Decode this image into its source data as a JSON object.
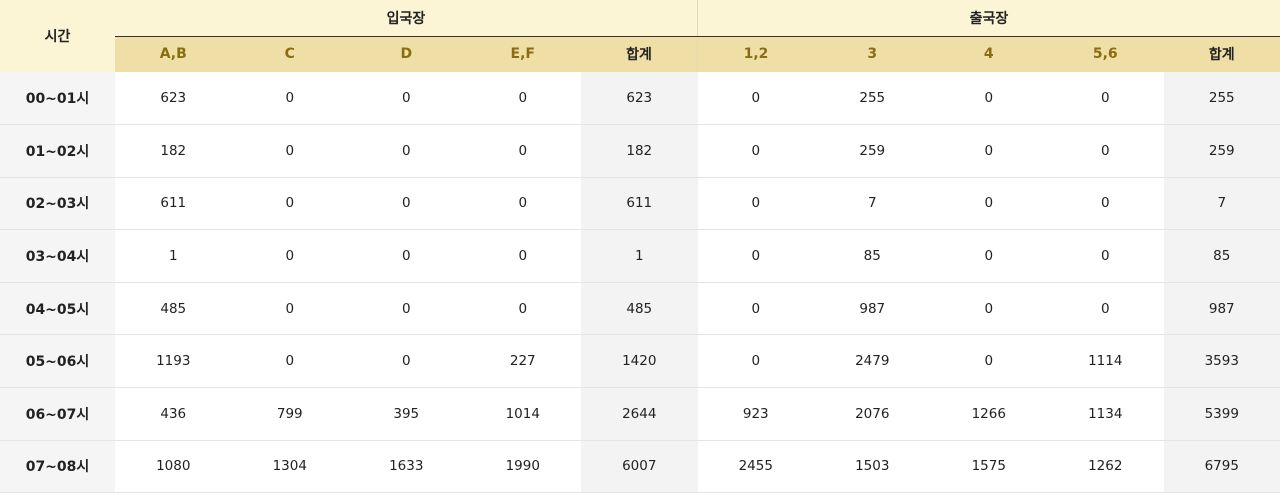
{
  "header": {
    "time_label": "시간",
    "arrival_label": "입국장",
    "departure_label": "출국장",
    "arrival_columns": [
      "A,B",
      "C",
      "D",
      "E,F",
      "합계"
    ],
    "departure_columns": [
      "1,2",
      "3",
      "4",
      "5,6",
      "합계"
    ]
  },
  "rows": [
    {
      "time": "00~01시",
      "arrival": [
        "623",
        "0",
        "0",
        "0",
        "623"
      ],
      "departure": [
        "0",
        "255",
        "0",
        "0",
        "255"
      ]
    },
    {
      "time": "01~02시",
      "arrival": [
        "182",
        "0",
        "0",
        "0",
        "182"
      ],
      "departure": [
        "0",
        "259",
        "0",
        "0",
        "259"
      ]
    },
    {
      "time": "02~03시",
      "arrival": [
        "611",
        "0",
        "0",
        "0",
        "611"
      ],
      "departure": [
        "0",
        "7",
        "0",
        "0",
        "7"
      ]
    },
    {
      "time": "03~04시",
      "arrival": [
        "1",
        "0",
        "0",
        "0",
        "1"
      ],
      "departure": [
        "0",
        "85",
        "0",
        "0",
        "85"
      ]
    },
    {
      "time": "04~05시",
      "arrival": [
        "485",
        "0",
        "0",
        "0",
        "485"
      ],
      "departure": [
        "0",
        "987",
        "0",
        "0",
        "987"
      ]
    },
    {
      "time": "05~06시",
      "arrival": [
        "1193",
        "0",
        "0",
        "227",
        "1420"
      ],
      "departure": [
        "0",
        "2479",
        "0",
        "1114",
        "3593"
      ]
    },
    {
      "time": "06~07시",
      "arrival": [
        "436",
        "799",
        "395",
        "1014",
        "2644"
      ],
      "departure": [
        "923",
        "2076",
        "1266",
        "1134",
        "5399"
      ]
    },
    {
      "time": "07~08시",
      "arrival": [
        "1080",
        "1304",
        "1633",
        "1990",
        "6007"
      ],
      "departure": [
        "2455",
        "1503",
        "1575",
        "1262",
        "6795"
      ]
    }
  ],
  "colors": {
    "group_header_bg": "#fbf4d5",
    "column_header_bg": "#efdfa6",
    "column_header_text": "#8a6d12",
    "time_cell_bg": "#f5f5f5",
    "sum_cell_bg": "#f3f3f3"
  }
}
